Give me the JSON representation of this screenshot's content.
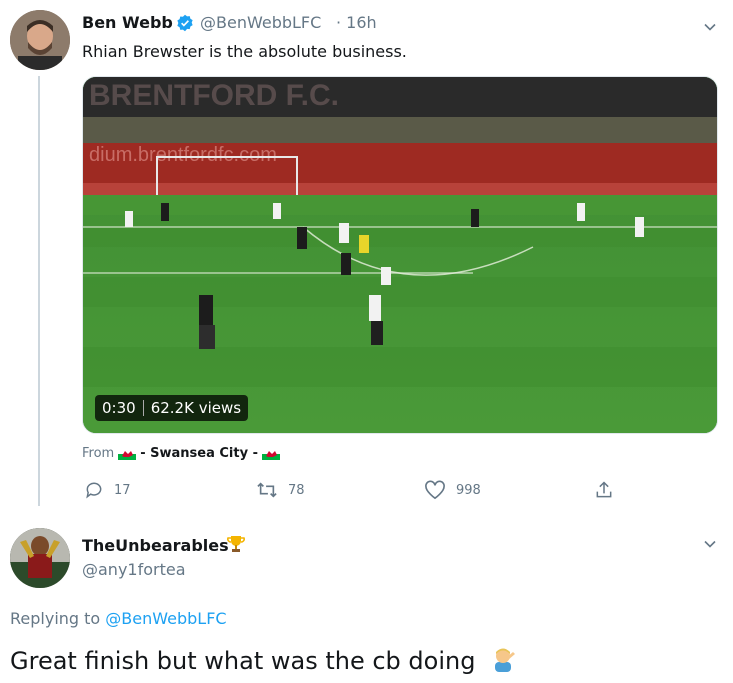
{
  "tweet": {
    "author_name": "Ben Webb",
    "author_handle": "@BenWebbLFC",
    "time": "· 16h",
    "text": "Rhian Brewster is the absolute business.",
    "video": {
      "duration": "0:30",
      "views": "62.2K views"
    },
    "from": {
      "label": "From",
      "source": "- Swansea City -"
    },
    "actions": {
      "replies": "17",
      "retweets": "78",
      "likes": "998"
    }
  },
  "reply": {
    "author_name": "TheUnbearables",
    "author_handle": "@any1fortea",
    "replying_label": "Replying to",
    "replying_handle": "@BenWebbLFC",
    "text": "Great finish but what was the cb doing"
  },
  "colors": {
    "accent": "#1da1f2",
    "secondary_text": "#657786",
    "primary_text": "#14171a"
  }
}
